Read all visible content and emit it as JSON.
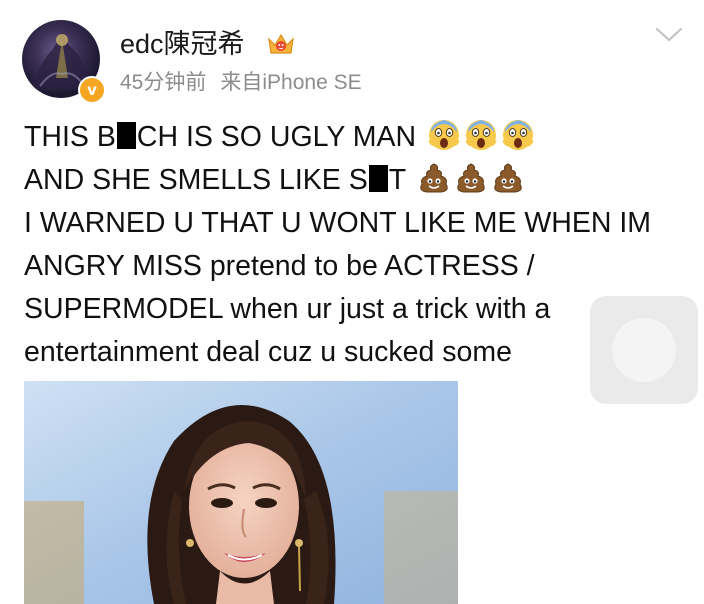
{
  "header": {
    "username": "edc陳冠希",
    "verified_mark": "v",
    "time_ago": "45分钟前",
    "source": "来自iPhone SE",
    "crown_badge_icon": "crown-badge-icon",
    "chevron_icon": "chevron-down-icon"
  },
  "post": {
    "line1_a": "THIS B",
    "line1_b": "CH IS SO UGLY MAN",
    "line1_emoji": "screaming-face-emoji",
    "line2_a": "AND SHE SMELLS LIKE S",
    "line2_b": "T",
    "line2_emoji": "poop-emoji",
    "line3": "I WARNED U THAT U WONT LIKE ME WHEN IM",
    "line4": "ANGRY MISS pretend to be ACTRESS /",
    "line5": "SUPERMODEL when ur just a trick with a",
    "line6": "entertainment deal cuz u sucked some"
  },
  "colors": {
    "text": "#111111",
    "meta": "#8c8c8c",
    "badge": "#f5a623"
  }
}
